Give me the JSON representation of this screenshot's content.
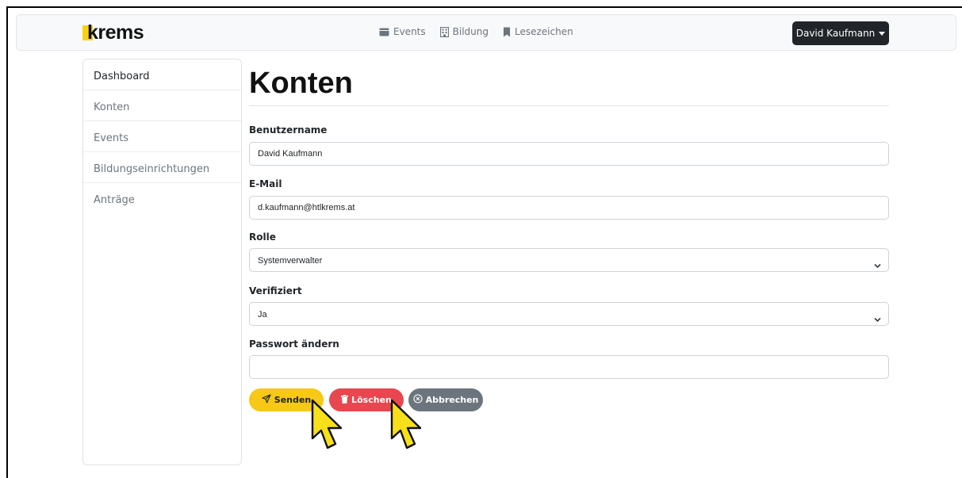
{
  "brand": {
    "name": "krems",
    "accent": "#f7d117"
  },
  "nav": {
    "links": [
      {
        "label": "Events",
        "icon": "calendar-icon"
      },
      {
        "label": "Bildung",
        "icon": "building-icon"
      },
      {
        "label": "Lesezeichen",
        "icon": "bookmark-icon"
      }
    ],
    "user_label": "David Kaufmann"
  },
  "sidebar": {
    "items": [
      {
        "label": "Dashboard"
      },
      {
        "label": "Konten"
      },
      {
        "label": "Events"
      },
      {
        "label": "Bildungseinrichtungen"
      },
      {
        "label": "Anträge"
      }
    ]
  },
  "page": {
    "title": "Konten"
  },
  "form": {
    "username": {
      "label": "Benutzername",
      "value": "David Kaufmann"
    },
    "email": {
      "label": "E-Mail",
      "value": "d.kaufmann@htlkrems.at"
    },
    "role": {
      "label": "Rolle",
      "value": "Systemverwalter"
    },
    "verified": {
      "label": "Verifiziert",
      "value": "Ja"
    },
    "password": {
      "label": "Passwort ändern",
      "value": ""
    }
  },
  "buttons": {
    "send": {
      "label": "Senden",
      "color": "#f7c815"
    },
    "delete": {
      "label": "Löschen",
      "color": "#e8474f"
    },
    "cancel": {
      "label": "Abbrechen",
      "color": "#6c757d"
    }
  }
}
